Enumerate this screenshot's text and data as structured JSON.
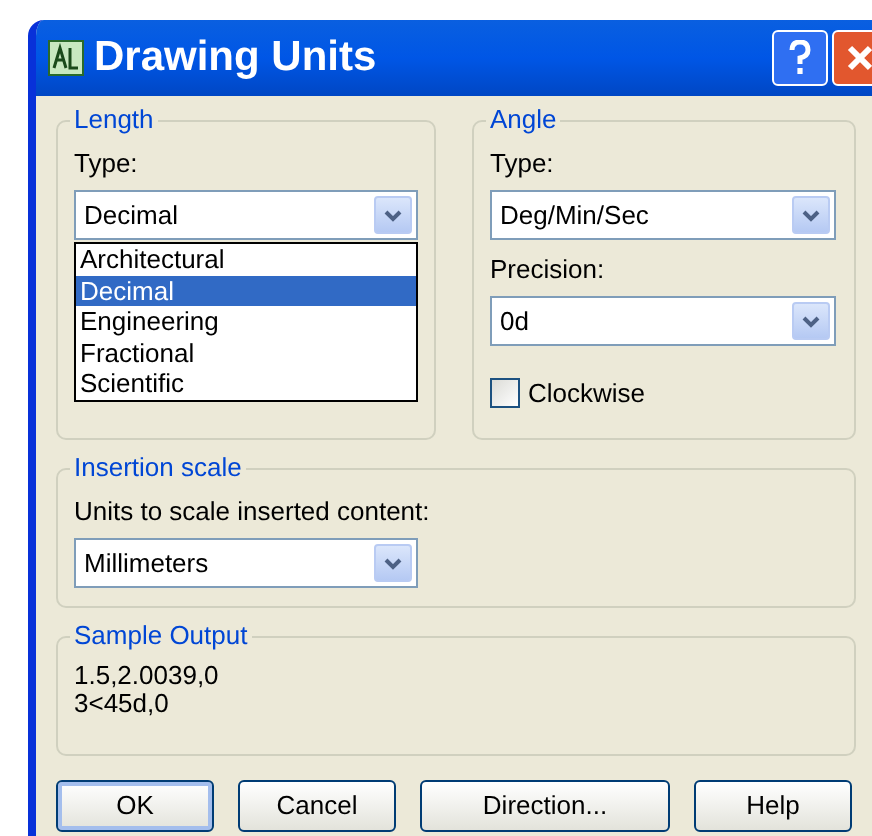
{
  "window": {
    "title": "Drawing Units"
  },
  "length": {
    "label": "Length",
    "type_label": "Type:",
    "type_value": "Decimal",
    "options": [
      {
        "label": "Architectural",
        "selected": false
      },
      {
        "label": "Decimal",
        "selected": true
      },
      {
        "label": "Engineering",
        "selected": false
      },
      {
        "label": "Fractional",
        "selected": false
      },
      {
        "label": "Scientific",
        "selected": false
      }
    ]
  },
  "angle": {
    "label": "Angle",
    "type_label": "Type:",
    "type_value": "Deg/Min/Sec",
    "precision_label": "Precision:",
    "precision_value": "0d",
    "clockwise": {
      "label": "Clockwise",
      "checked": false
    }
  },
  "insertion_scale": {
    "label": "Insertion scale",
    "units_label": "Units to scale inserted content:",
    "units_value": "Millimeters"
  },
  "sample_output": {
    "label": "Sample Output",
    "lines": [
      "1.5,2.0039,0",
      "3<45d,0"
    ]
  },
  "buttons": [
    {
      "label": "OK",
      "default": true
    },
    {
      "label": "Cancel",
      "default": false
    },
    {
      "label": "Direction...",
      "default": false
    },
    {
      "label": "Help",
      "default": false
    }
  ]
}
